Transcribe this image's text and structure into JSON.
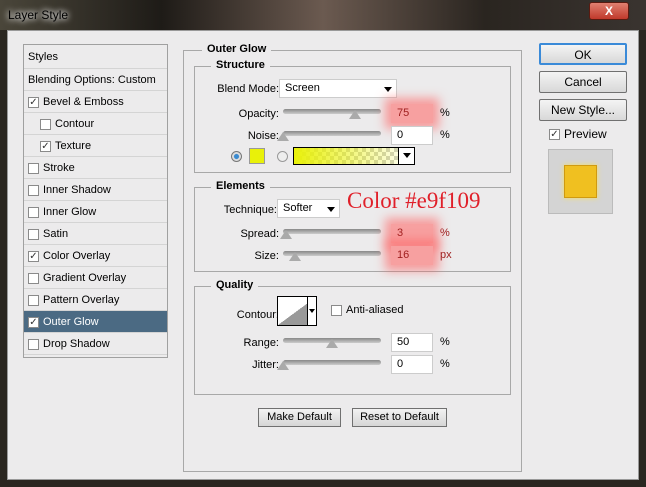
{
  "window": {
    "title": "Layer Style",
    "close": "X"
  },
  "sidebar": {
    "items": [
      {
        "label": "Styles",
        "checkbox": false
      },
      {
        "label": "Blending Options: Custom",
        "checkbox": false
      },
      {
        "label": "Bevel & Emboss",
        "checkbox": true,
        "checked": true
      },
      {
        "label": "Contour",
        "checkbox": true,
        "checked": false,
        "indent": true
      },
      {
        "label": "Texture",
        "checkbox": true,
        "checked": true,
        "indent": true
      },
      {
        "label": "Stroke",
        "checkbox": true,
        "checked": false
      },
      {
        "label": "Inner Shadow",
        "checkbox": true,
        "checked": false
      },
      {
        "label": "Inner Glow",
        "checkbox": true,
        "checked": false
      },
      {
        "label": "Satin",
        "checkbox": true,
        "checked": false
      },
      {
        "label": "Color Overlay",
        "checkbox": true,
        "checked": true
      },
      {
        "label": "Gradient Overlay",
        "checkbox": true,
        "checked": false
      },
      {
        "label": "Pattern Overlay",
        "checkbox": true,
        "checked": false
      },
      {
        "label": "Outer Glow",
        "checkbox": true,
        "checked": true,
        "selected": true
      },
      {
        "label": "Drop Shadow",
        "checkbox": true,
        "checked": false
      }
    ]
  },
  "outer_glow": {
    "title": "Outer Glow",
    "structure": {
      "title": "Structure",
      "blend_mode_label": "Blend Mode:",
      "blend_mode": "Screen",
      "opacity_label": "Opacity:",
      "opacity": "75",
      "opacity_unit": "%",
      "noise_label": "Noise:",
      "noise": "0",
      "noise_unit": "%",
      "glow_color": "#e9f109"
    },
    "elements": {
      "title": "Elements",
      "technique_label": "Technique:",
      "technique": "Softer",
      "spread_label": "Spread:",
      "spread": "3",
      "spread_unit": "%",
      "size_label": "Size:",
      "size": "16",
      "size_unit": "px"
    },
    "quality": {
      "title": "Quality",
      "contour_label": "Contour:",
      "anti_aliased": "Anti-aliased",
      "range_label": "Range:",
      "range": "50",
      "range_unit": "%",
      "jitter_label": "Jitter:",
      "jitter": "0",
      "jitter_unit": "%"
    },
    "make_default": "Make Default",
    "reset_default": "Reset to Default"
  },
  "annotation": "Color #e9f109",
  "buttons": {
    "ok": "OK",
    "cancel": "Cancel",
    "new_style": "New Style...",
    "preview": "Preview"
  }
}
